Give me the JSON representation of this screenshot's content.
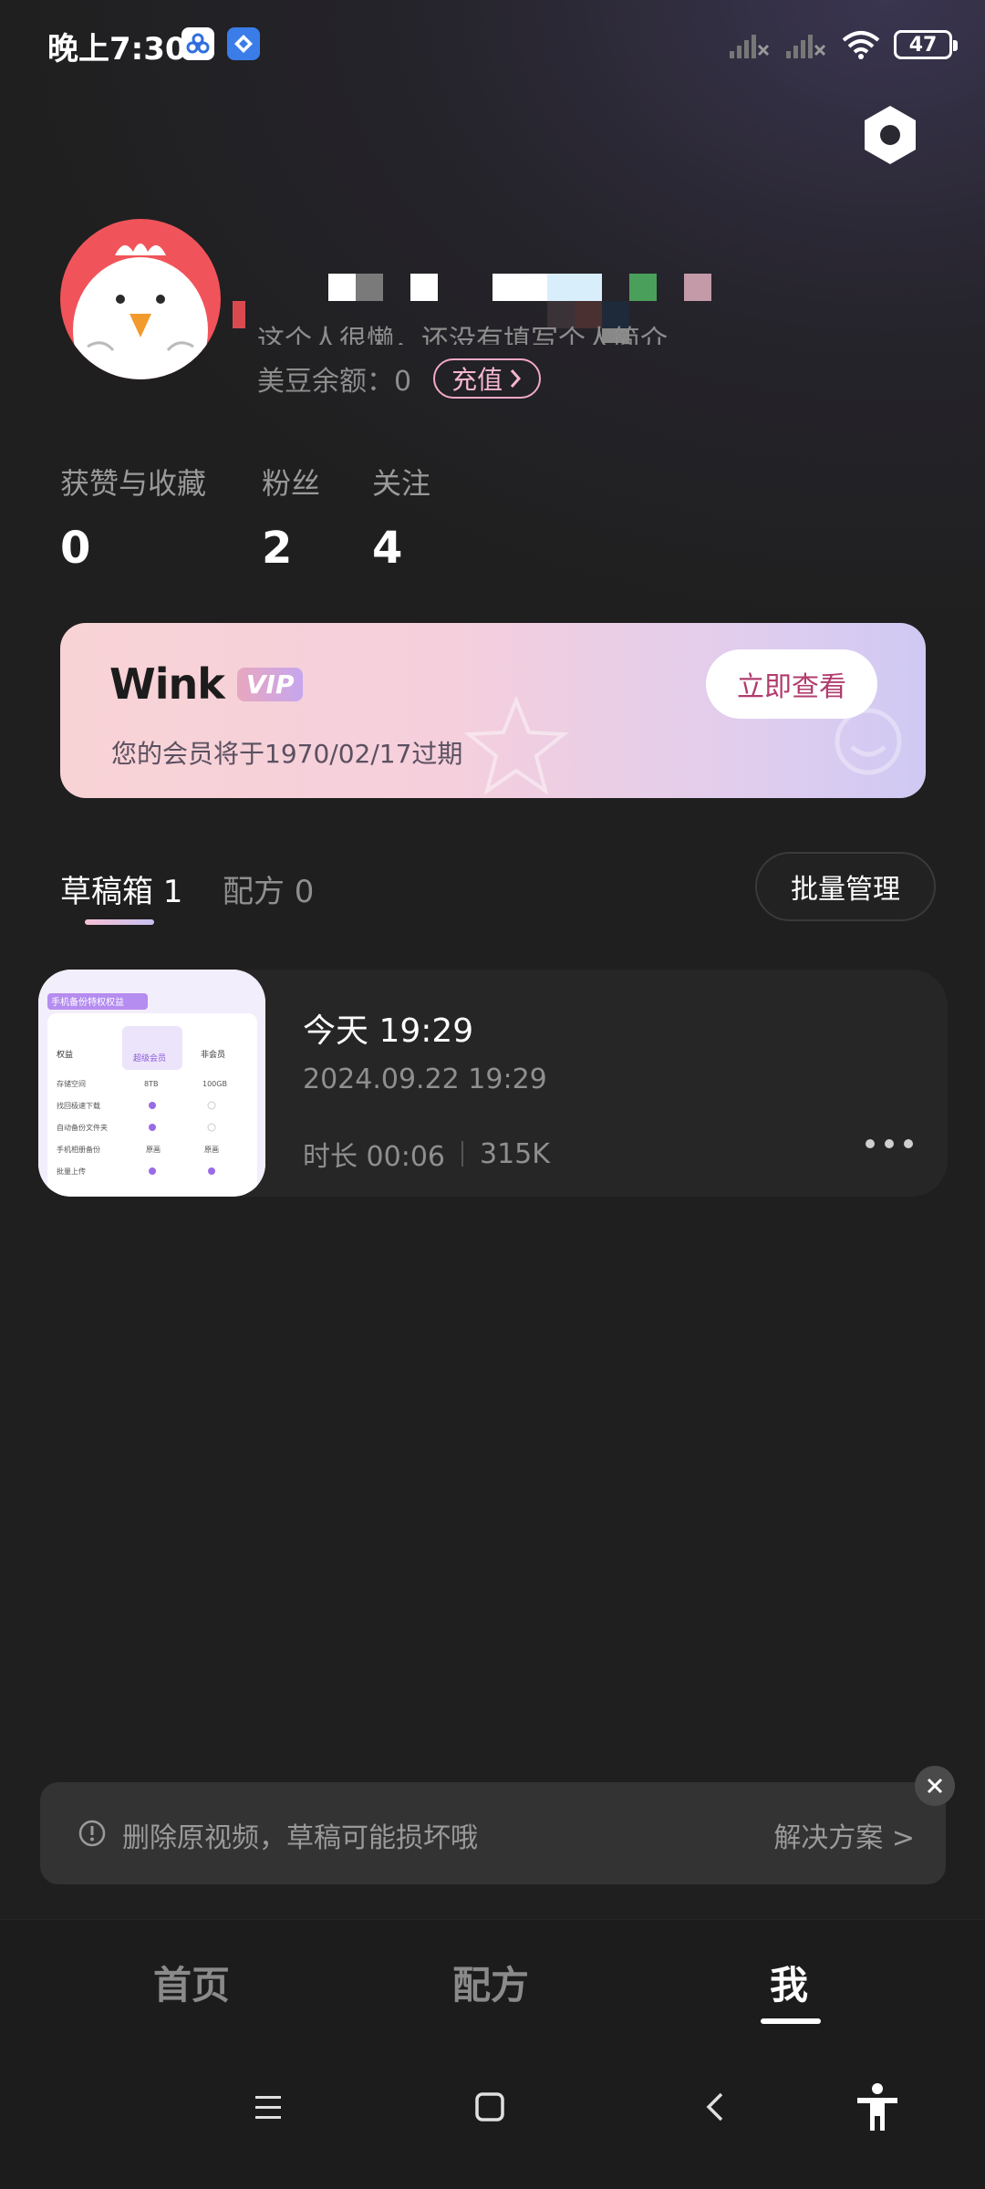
{
  "status_bar": {
    "time": "晚上7:30",
    "battery": "47"
  },
  "profile": {
    "bio": "这个人很懒，还没有填写个人简介",
    "balance_label": "美豆余额：0",
    "recharge_label": "充值"
  },
  "stats": {
    "likes_label": "获赞与收藏",
    "likes_value": "0",
    "fans_label": "粉丝",
    "fans_value": "2",
    "following_label": "关注",
    "following_value": "4"
  },
  "vip": {
    "brand": "Wink",
    "badge": "VIP",
    "expiry_text": "您的会员将于1970/02/17过期",
    "view_button": "立即查看"
  },
  "tabs": {
    "drafts": "草稿箱 1",
    "recipes": "配方 0",
    "batch_manage": "批量管理"
  },
  "draft": {
    "title": "今天 19:29",
    "date": "2024.09.22 19:29",
    "duration": "时长 00:06",
    "size": "315K",
    "thumb_text": {
      "header": "手机备份特权权益",
      "col1": "权益",
      "col2": "超级会员",
      "col3": "非会员",
      "row1": "存储空间",
      "row1_v1": "8TB",
      "row1_v2": "100GB",
      "row2": "找回极速下载",
      "row3": "自动备份文件夹",
      "row4": "手机相册备份",
      "row4_v1": "原画",
      "row4_v2": "原画",
      "row5": "批量上传"
    }
  },
  "warning": {
    "text": "删除原视频，草稿可能损坏哦",
    "link": "解决方案 >"
  },
  "bottom_nav": {
    "home": "首页",
    "recipe": "配方",
    "me": "我"
  },
  "icons": {
    "settings": "settings-hex-icon",
    "menu": "menu-icon",
    "home": "home-square-icon",
    "back": "back-chevron-icon",
    "accessibility": "accessibility-icon"
  },
  "colors": {
    "background": "#1f1f1f",
    "accent_pink": "#f3a9c7",
    "vip_button_text": "#b13c6e"
  }
}
